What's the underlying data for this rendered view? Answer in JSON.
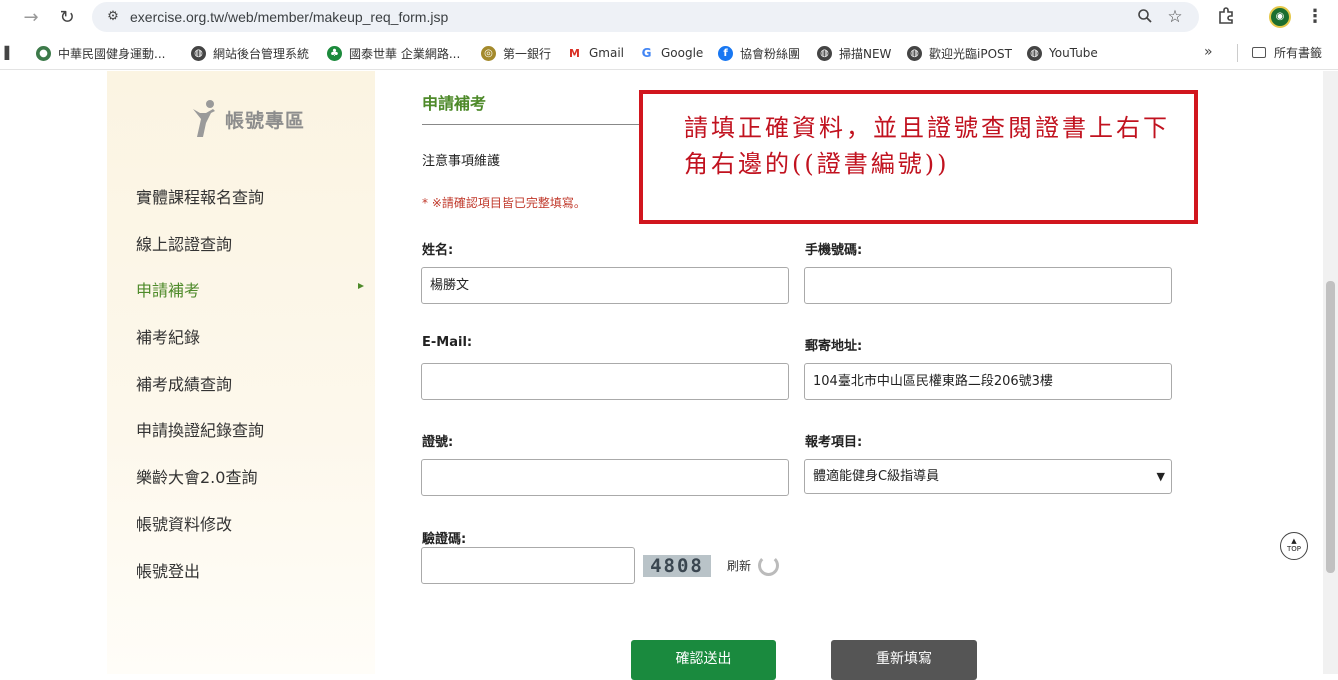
{
  "browser": {
    "url": "exercise.org.tw/web/member/makeup_req_form.jsp",
    "bookmarks": [
      {
        "label": "中華民國健身運動...",
        "icon": "org-logo-icon",
        "color": "#3d7a4a"
      },
      {
        "label": "網站後台管理系統",
        "icon": "globe-icon",
        "color": "#444444"
      },
      {
        "label": "國泰世華 企業網路...",
        "icon": "tree-icon",
        "color": "#1c8a3c"
      },
      {
        "label": "第一銀行",
        "icon": "bank-icon",
        "color": "#a48a2c"
      },
      {
        "label": "Gmail",
        "icon": "gmail-icon",
        "color": "#d93025"
      },
      {
        "label": "Google",
        "icon": "google-icon",
        "color": "#4285f4"
      },
      {
        "label": "協會粉絲團",
        "icon": "facebook-icon",
        "color": "#1877f2"
      },
      {
        "label": "掃描NEW",
        "icon": "globe-icon",
        "color": "#444444"
      },
      {
        "label": "歡迎光臨iPOST",
        "icon": "globe-icon",
        "color": "#444444"
      },
      {
        "label": "YouTube",
        "icon": "globe-icon",
        "color": "#444444"
      }
    ],
    "more_label": "»",
    "all_bookmarks_label": "所有書籤"
  },
  "sidebar": {
    "title": "帳號專區",
    "items": [
      {
        "label": "實體課程報名查詢"
      },
      {
        "label": "線上認證查詢"
      },
      {
        "label": "申請補考",
        "active": true
      },
      {
        "label": "補考紀錄"
      },
      {
        "label": "補考成績查詢"
      },
      {
        "label": "申請換證紀錄查詢"
      },
      {
        "label": "樂齡大會2.0查詢"
      },
      {
        "label": "帳號資料修改"
      },
      {
        "label": "帳號登出"
      }
    ]
  },
  "form": {
    "section_title": "申請補考",
    "notice_link": "注意事項維護",
    "required_note": "* ※請確認項目皆已完整填寫。",
    "name_label": "姓名:",
    "name_value": "楊勝文",
    "phone_label": "手機號碼:",
    "phone_value": "",
    "email_label": "E-Mail:",
    "email_value": "",
    "address_label": "郵寄地址:",
    "address_value": "104臺北市中山區民權東路二段206號3樓",
    "cert_label": "證號:",
    "cert_value": "",
    "exam_item_label": "報考項目:",
    "exam_item_value": "體適能健身C級指導員",
    "captcha_label": "驗證碼:",
    "captcha_value": "",
    "captcha_code": "4808",
    "refresh_label": "刷新",
    "submit_label": "確認送出",
    "reset_label": "重新填寫"
  },
  "annotation": {
    "text": "請填正確資料，並且證號查閱證書上右下角右邊的((證書編號))",
    "border_color": "#d1161e"
  },
  "top_button": {
    "label": "TOP"
  },
  "colors": {
    "accent_green": "#4e8a2a",
    "submit_green": "#1a8a3e",
    "reset_gray": "#555555"
  }
}
